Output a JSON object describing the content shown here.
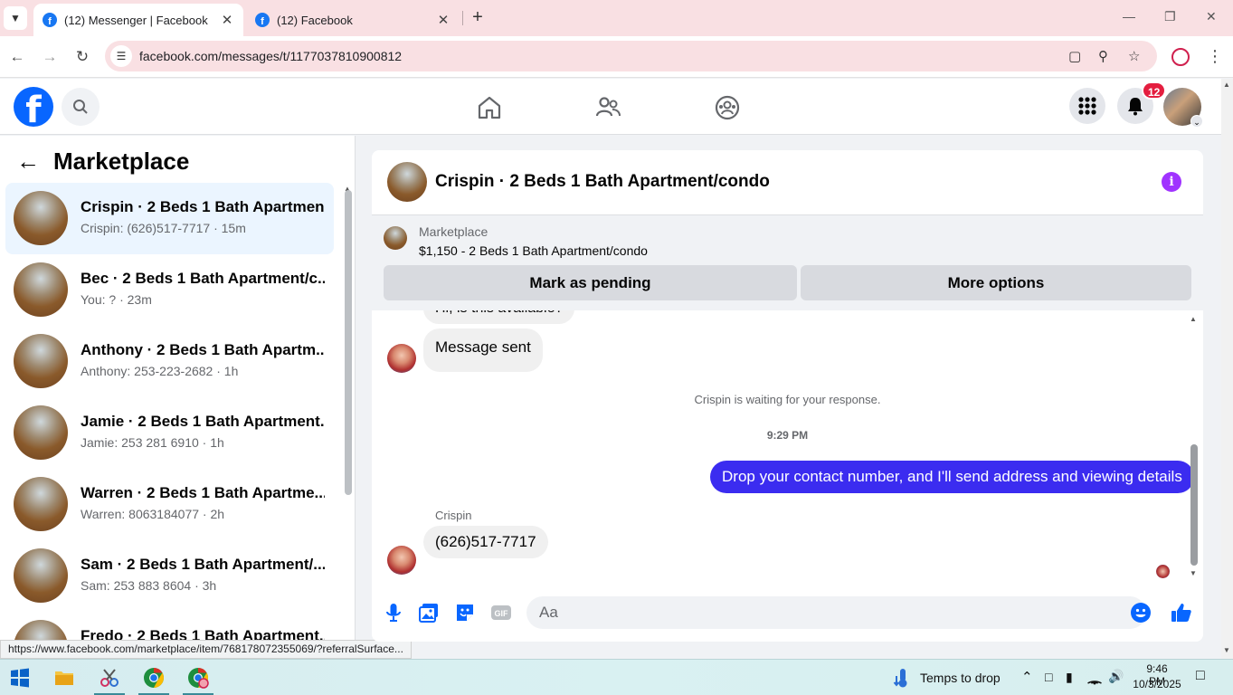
{
  "browser": {
    "tabs": [
      {
        "title": "(12) Messenger | Facebook",
        "active": true
      },
      {
        "title": "(12) Facebook",
        "active": false
      }
    ],
    "url": "facebook.com/messages/t/1177037810900812",
    "status_url": "https://www.facebook.com/marketplace/item/768178072355069/?referralSurface..."
  },
  "fb_header": {
    "logo": "f",
    "notification_count": "12"
  },
  "left_panel": {
    "title": "Marketplace",
    "conversations": [
      {
        "name": "Crispin · 2 Beds 1 Bath Apartmen...",
        "sub": "Crispin: (626)517-7717 · 15m",
        "active": true
      },
      {
        "name": "Bec · 2 Beds 1 Bath Apartment/c...",
        "sub": "You: ? · 23m"
      },
      {
        "name": "Anthony · 2 Beds 1 Bath Apartm...",
        "sub": "Anthony: 253-223-2682 · 1h"
      },
      {
        "name": "Jamie · 2 Beds 1 Bath Apartment...",
        "sub": "Jamie: 253 281 6910 · 1h"
      },
      {
        "name": "Warren · 2 Beds 1 Bath Apartme...",
        "sub": "Warren: 8063184077 · 2h"
      },
      {
        "name": "Sam · 2 Beds 1 Bath Apartment/...",
        "sub": "Sam: 253 883 8604 · 3h"
      },
      {
        "name": "Fredo · 2 Beds 1 Bath Apartment...",
        "sub": ""
      }
    ]
  },
  "chat": {
    "title": "Crispin · 2 Beds 1 Bath Apartment/condo",
    "info_icon": "i",
    "marketplace": {
      "label": "Marketplace",
      "price_title": "$1,150 - 2 Beds 1 Bath Apartment/condo",
      "mark_pending": "Mark as pending",
      "more_options": "More options"
    },
    "partial_msg": "Hi, is this available?",
    "msg_sent": "Message sent",
    "waiting": "Crispin is waiting for your response.",
    "time": "9:29 PM",
    "outgoing": "Drop your contact number, and I'll send address and viewing details",
    "sender": "Crispin",
    "reply": "(626)517-7717",
    "composer_placeholder": "Aa"
  },
  "taskbar": {
    "weather": "Temps to drop",
    "time": "9:46 PM",
    "date": "10/3/2025"
  }
}
